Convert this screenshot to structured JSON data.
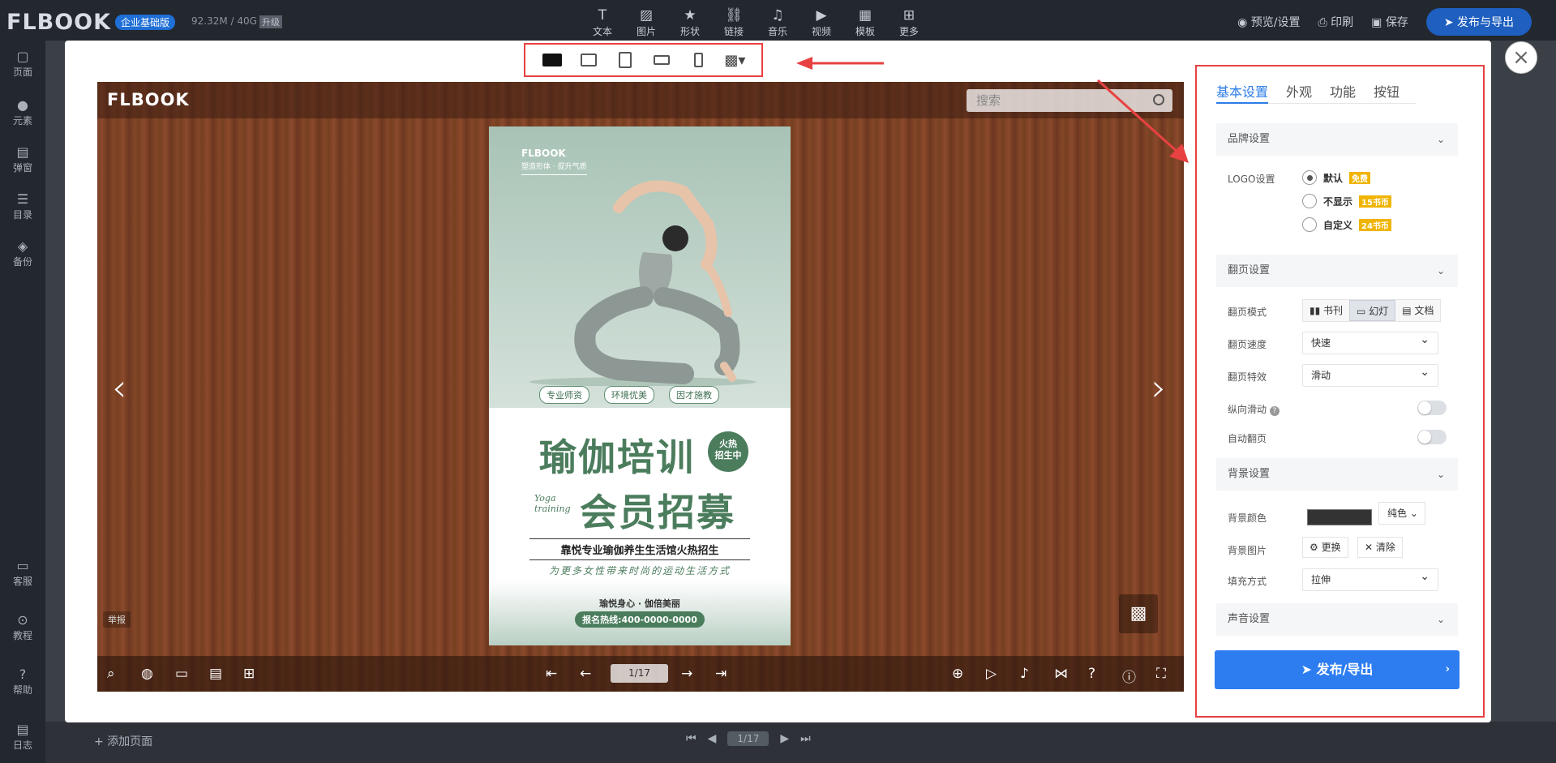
{
  "app": {
    "logo": "FLBOOK",
    "plan_badge": "企业基础版",
    "storage": "92.32M / 40G",
    "upgrade": "升级",
    "tools": [
      {
        "label": "文本",
        "icon": "text-icon"
      },
      {
        "label": "图片",
        "icon": "image-icon"
      },
      {
        "label": "形状",
        "icon": "star-icon"
      },
      {
        "label": "链接",
        "icon": "link-icon"
      },
      {
        "label": "音乐",
        "icon": "music-icon"
      },
      {
        "label": "视频",
        "icon": "video-icon"
      },
      {
        "label": "模板",
        "icon": "template-icon"
      },
      {
        "label": "更多",
        "icon": "more-icon"
      }
    ],
    "actions": {
      "preview": "预览/设置",
      "print": "印刷",
      "save": "保存",
      "publish": "发布与导出"
    }
  },
  "sidebar": {
    "items": [
      {
        "label": "页面",
        "icon": "page-icon"
      },
      {
        "label": "元素",
        "icon": "element-icon"
      },
      {
        "label": "弹窗",
        "icon": "popup-icon"
      },
      {
        "label": "目录",
        "icon": "list-icon"
      },
      {
        "label": "备份",
        "icon": "layers-icon"
      },
      {
        "label": "客服",
        "icon": "chat-icon"
      },
      {
        "label": "教程",
        "icon": "play-icon"
      },
      {
        "label": "帮助",
        "icon": "help-icon"
      },
      {
        "label": "日志",
        "icon": "log-icon"
      }
    ]
  },
  "bg_bottom": {
    "add_page": "添加页面",
    "page": "1/17"
  },
  "preview": {
    "logo": "FLBOOK",
    "search_placeholder": "搜索",
    "report": "举报",
    "page": "1/17"
  },
  "poster": {
    "brand": "FLBOOK",
    "slogan": "塑造形体 · 提升气质",
    "tags": [
      "专业师资",
      "环境优美",
      "因才施教"
    ],
    "title1": "瑜伽培训",
    "title2": "会员招募",
    "badge_line1": "火热",
    "badge_line2": "招生中",
    "script_line1": "Yoga",
    "script_line2": "training",
    "subtitle": "靠悦专业瑜伽养生生活馆火热招生",
    "subtitle2": "为更多女性带来时尚的运动生活方式",
    "footer": "瑜悦身心 · 伽倍美丽",
    "hotline": "报名热线:400-0000-0000"
  },
  "settings": {
    "tabs": [
      "基本设置",
      "外观",
      "功能",
      "按钮"
    ],
    "brand_section": "品牌设置",
    "logo_label": "LOGO设置",
    "logo_options": [
      {
        "label": "默认",
        "price": "免费",
        "checked": true
      },
      {
        "label": "不显示",
        "price": "15书币",
        "checked": false
      },
      {
        "label": "自定义",
        "price": "24书币",
        "checked": false
      }
    ],
    "flip_section": "翻页设置",
    "flip_mode_label": "翻页模式",
    "flip_modes": [
      "书刊",
      "幻灯",
      "文档"
    ],
    "flip_speed_label": "翻页速度",
    "flip_speed": "快速",
    "flip_effect_label": "翻页特效",
    "flip_effect": "滑动",
    "vertical_label": "纵向滑动",
    "auto_label": "自动翻页",
    "bg_section": "背景设置",
    "bg_color_label": "背景颜色",
    "bg_color": "#333333",
    "bg_color_mode": "纯色",
    "bg_image_label": "背景图片",
    "replace": "更换",
    "clear": "清除",
    "fill_label": "填充方式",
    "fill": "拉伸",
    "sound_section": "声音设置",
    "publish": "发布/导出"
  },
  "colors": {
    "accent": "#2d7df0",
    "annotation": "#e84141",
    "poster_green": "#4b7d5d"
  }
}
